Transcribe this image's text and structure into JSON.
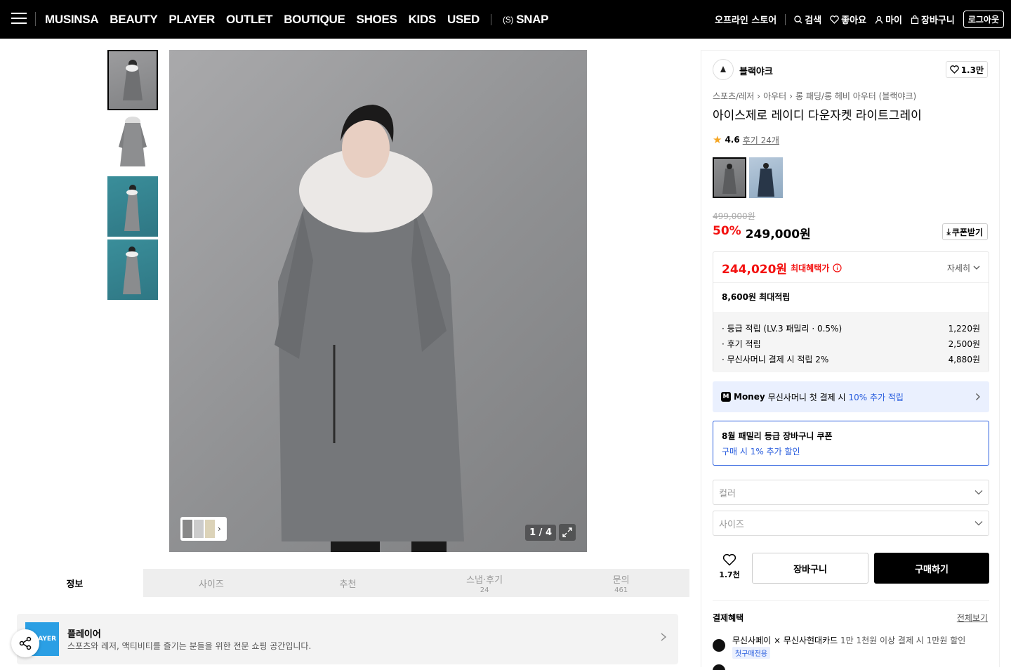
{
  "nav": {
    "categories": [
      "MUSINSA",
      "BEAUTY",
      "PLAYER",
      "OUTLET",
      "BOUTIQUE",
      "SHOES",
      "KIDS",
      "USED"
    ],
    "snap_label": "SNAP",
    "offline_store": "오프라인 스토어",
    "search": "검색",
    "likes": "좋아요",
    "my": "마이",
    "cart": "장바구니",
    "logout": "로그아웃"
  },
  "gallery": {
    "counter": "1 / 4",
    "thumbnail_icons": [
      "model-gray-thumb",
      "coat-flat-thumb",
      "model-teal-thumb",
      "model-teal-2-thumb"
    ]
  },
  "tabs": [
    {
      "label": "정보",
      "count": ""
    },
    {
      "label": "사이즈",
      "count": ""
    },
    {
      "label": "추천",
      "count": ""
    },
    {
      "label": "스냅·후기",
      "count": "24"
    },
    {
      "label": "문의",
      "count": "461"
    }
  ],
  "player": {
    "logo_text": "AYER",
    "title": "플레이어",
    "description": "스포츠와 레저, 액티비티를 즐기는 분들을 위한 전문 쇼핑 공간입니다."
  },
  "product": {
    "brand": "블랙야크",
    "likes": "1.3만",
    "breadcrumb": [
      "스포츠/레저",
      "아우터",
      "롱 패딩/롱 헤비 아우터 (블랙야크)"
    ],
    "title": "아이스제로 레이디 다운자켓 라이트그레이",
    "rating": "4.6",
    "reviews": "후기 24개",
    "original_price": "499,000원",
    "discount": "50%",
    "price": "249,000원",
    "coupon_label": "쿠폰받기"
  },
  "benefit": {
    "max_price": "244,020원",
    "max_label": "최대혜택가",
    "detail_label": "자세히",
    "points_total": "8,600원 최대적립",
    "points": [
      {
        "label": "· 등급 적립 (LV.3 패밀리 · 0.5%)",
        "value": "1,220원"
      },
      {
        "label": "· 후기 적립",
        "value": "2,500원"
      },
      {
        "label": "· 무신사머니 결제 시 적립 2%",
        "value": "4,880원"
      }
    ]
  },
  "money": {
    "icon": "M",
    "label": "Money",
    "text": "무신사머니 첫 결제 시",
    "highlight": "10% 추가 적립"
  },
  "family_coupon": {
    "title": "8월 패밀리 등급 장바구니 쿠폰",
    "subtitle": "구매 시 1% 추가 할인"
  },
  "options": {
    "color_placeholder": "컬러",
    "size_placeholder": "사이즈"
  },
  "actions": {
    "wish_count": "1.7천",
    "cart": "장바구니",
    "buy": "구매하기"
  },
  "payment": {
    "title": "결제혜택",
    "view_all": "전체보기",
    "items": [
      {
        "name": "무신사페이 × 무신사현대카드",
        "detail": "1만 1천원 이상 결제 시 1만원 할인",
        "tag": "첫구매전용"
      }
    ]
  },
  "colors": {
    "accent_red": "#f31110",
    "accent_blue": "#2a5ede",
    "nav_bg": "#000000"
  }
}
